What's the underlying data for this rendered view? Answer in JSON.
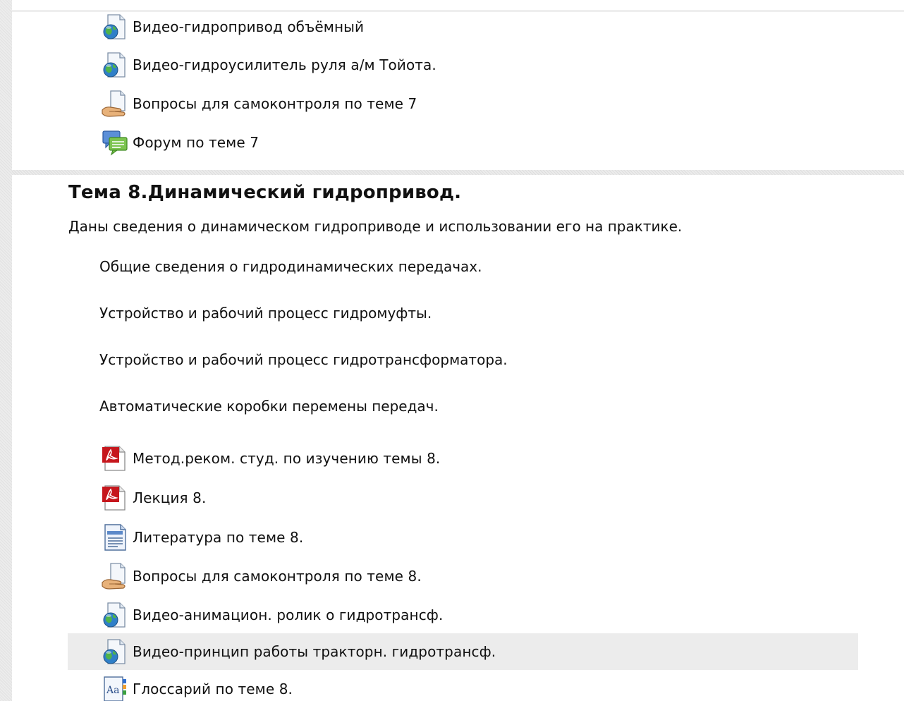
{
  "top_activities": [
    {
      "icon": "video-globe-icon",
      "label": "Видео-гидропривод объёмный"
    },
    {
      "icon": "video-globe-icon",
      "label": "Видео-гидроусилитель руля а/м Тойота."
    },
    {
      "icon": "quiz-hand-icon",
      "label": "Вопросы для самоконтроля по теме 7"
    },
    {
      "icon": "forum-icon",
      "label": "Форум по теме 7"
    }
  ],
  "section8": {
    "title": "Тема 8.Динамический гидропривод.",
    "summary": "Даны сведения о динамическом гидроприводе и использовании его на практике.",
    "subtopics": [
      "Общие сведения о гидродинамических передачах.",
      "Устройство и рабочий процесс гидромуфты.",
      "Устройство и рабочий процесс гидротрансформатора.",
      "Автоматические коробки перемены передач."
    ],
    "activities": [
      {
        "icon": "pdf-icon",
        "label": "Метод.реком. студ. по изучению темы 8."
      },
      {
        "icon": "pdf-icon",
        "label": "Лекция 8."
      },
      {
        "icon": "document-page-icon",
        "label": "Литература по теме 8."
      },
      {
        "icon": "quiz-hand-icon",
        "label": "Вопросы для самоконтроля по теме 8."
      },
      {
        "icon": "video-globe-icon",
        "label": "Видео-анимацион. ролик о гидротрансф."
      },
      {
        "icon": "video-globe-icon",
        "label": "Видео-принцип работы тракторн. гидротрансф.",
        "highlighted": true
      },
      {
        "icon": "glossary-icon",
        "label": "Глоссарий по теме 8."
      }
    ]
  }
}
